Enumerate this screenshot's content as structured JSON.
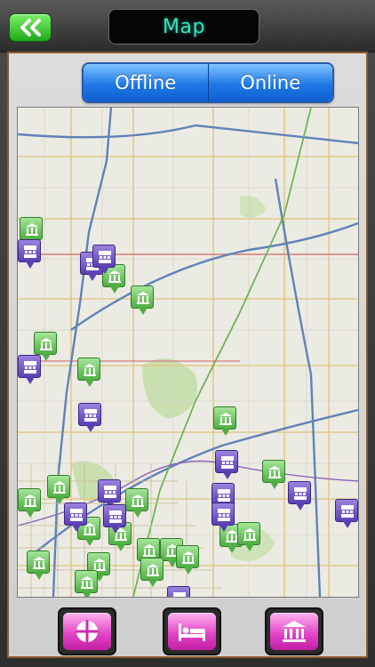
{
  "header": {
    "title": "Map",
    "back_icon": "double-chevron-left-icon",
    "back_color": "#2fbf25"
  },
  "segmented": {
    "options": [
      "Offline",
      "Online"
    ],
    "selected": "Offline"
  },
  "map": {
    "marker_types": [
      "museum-icon",
      "hotel-icon"
    ],
    "accent_museum": "#4fae43",
    "accent_hotel": "#5a3fb3"
  },
  "bottom_bar": {
    "buttons": [
      {
        "icon": "crosshair-icon"
      },
      {
        "icon": "bed-icon"
      },
      {
        "icon": "museum-icon"
      }
    ],
    "color": "#e040c4"
  }
}
